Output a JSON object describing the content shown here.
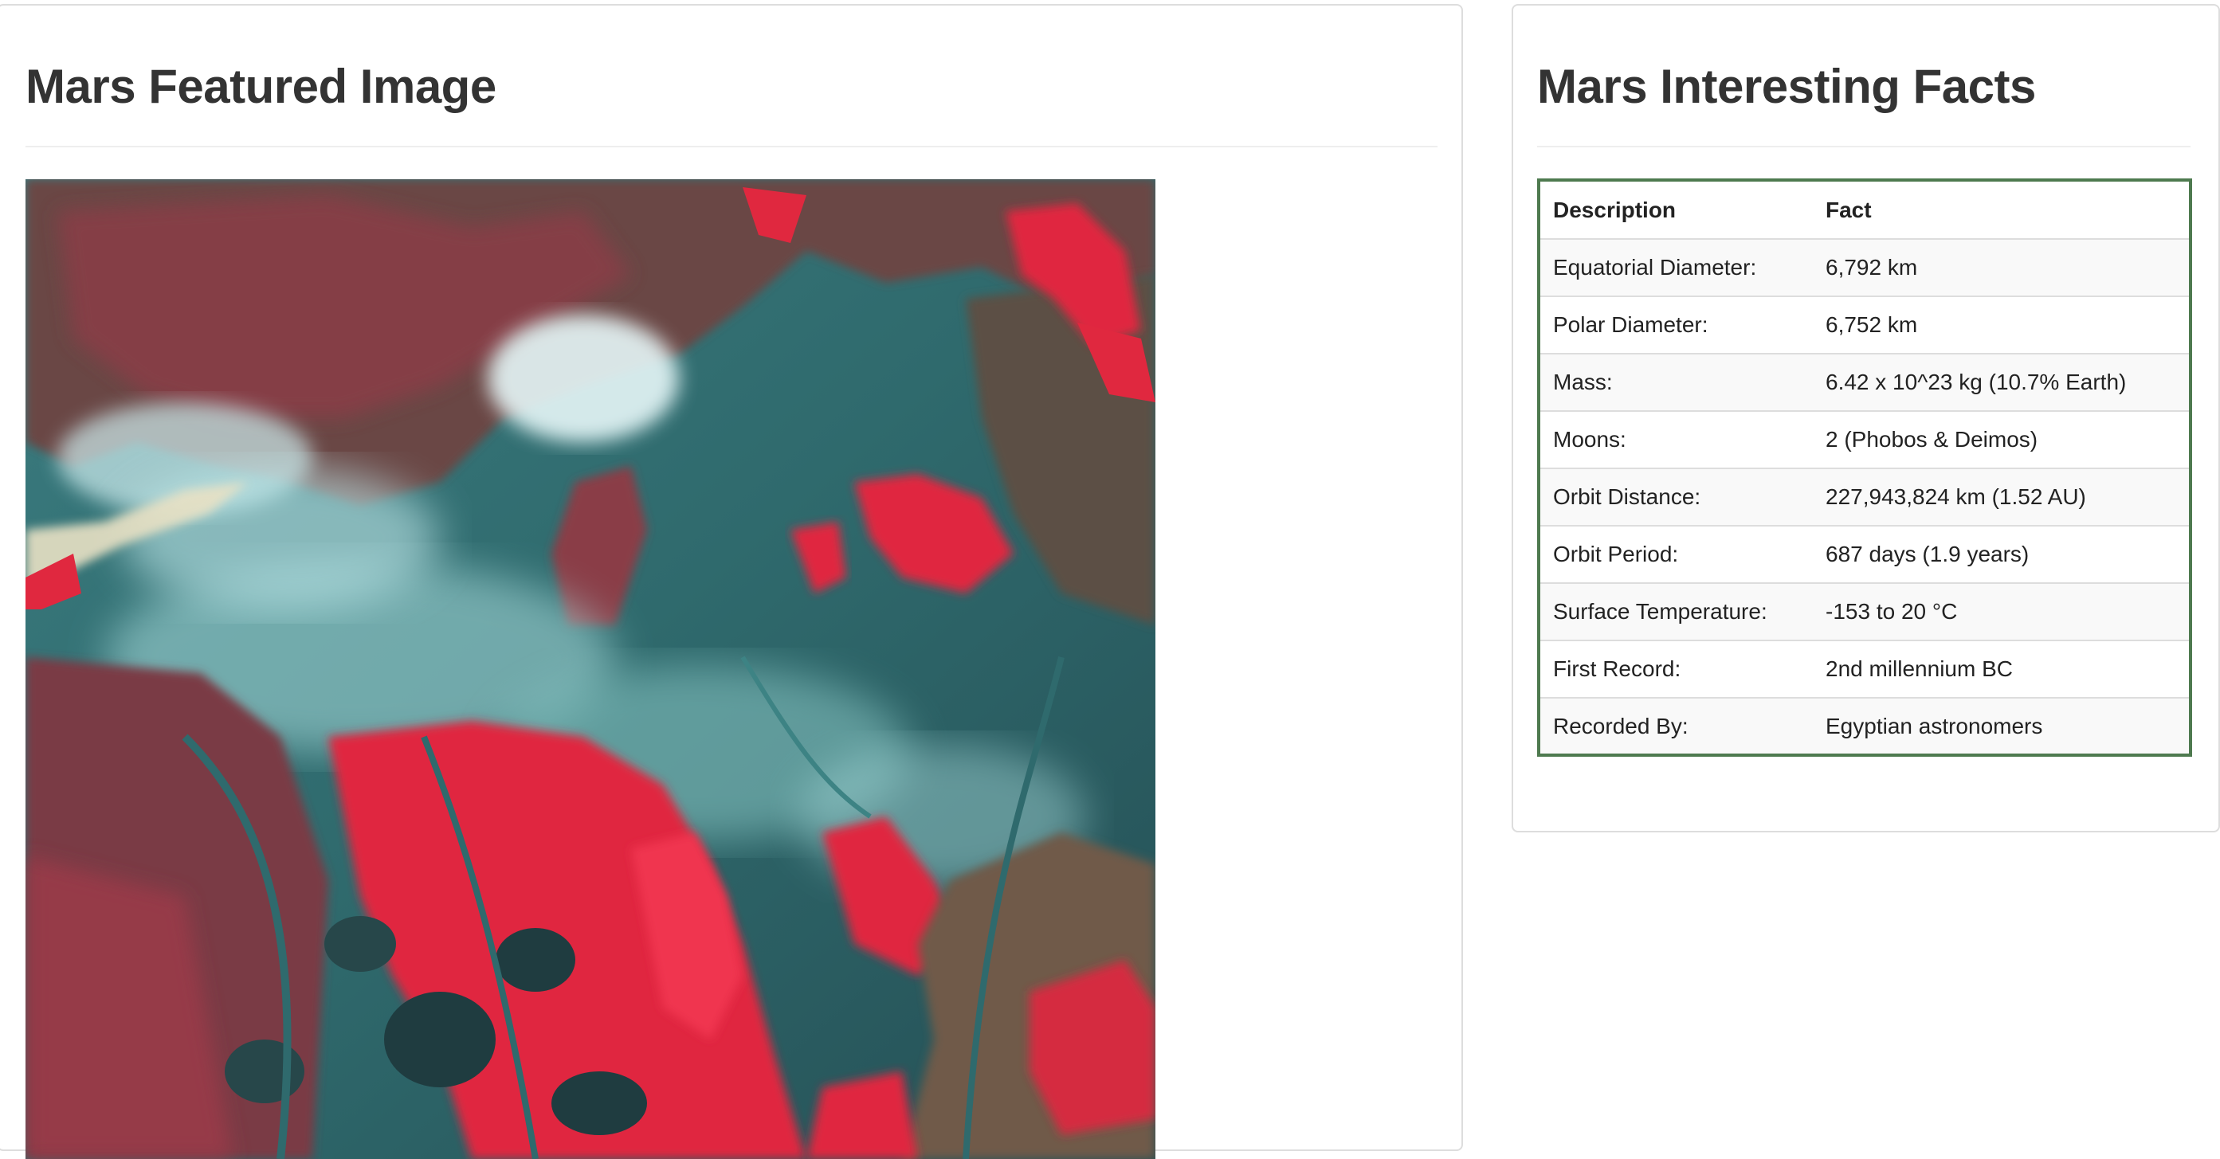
{
  "featured": {
    "title": "Mars Featured Image",
    "image_alt": "satellite false-color image"
  },
  "facts": {
    "title": "Mars Interesting Facts",
    "headers": [
      "Description",
      "Fact"
    ],
    "rows": [
      {
        "description": "Equatorial Diameter:",
        "fact": "6,792 km"
      },
      {
        "description": "Polar Diameter:",
        "fact": "6,752 km"
      },
      {
        "description": "Mass:",
        "fact": "6.42 x 10^23 kg (10.7% Earth)"
      },
      {
        "description": "Moons:",
        "fact": "2 (Phobos & Deimos)"
      },
      {
        "description": "Orbit Distance:",
        "fact": "227,943,824 km (1.52 AU)"
      },
      {
        "description": "Orbit Period:",
        "fact": "687 days (1.9 years)"
      },
      {
        "description": "Surface Temperature:",
        "fact": "-153 to 20 °C"
      },
      {
        "description": "First Record:",
        "fact": "2nd millennium BC"
      },
      {
        "description": "Recorded By:",
        "fact": "Egyptian astronomers"
      }
    ]
  },
  "colors": {
    "table_border": "#4e7a4f",
    "image_water": "#2f6a6d",
    "image_vegetation": "#e0283f",
    "image_cloud": "#d8f0f2"
  }
}
